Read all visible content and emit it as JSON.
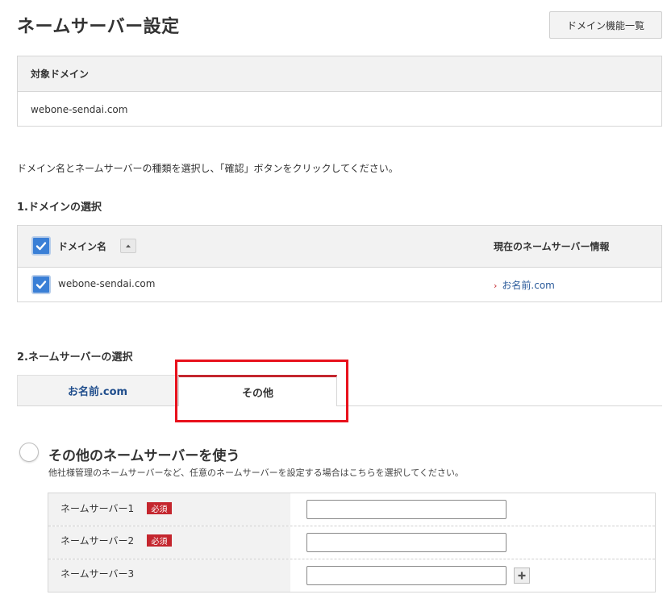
{
  "page": {
    "title": "ネームサーバー設定",
    "domain_list_button": "ドメイン機能一覧"
  },
  "target": {
    "header": "対象ドメイン",
    "value": "webone-sendai.com"
  },
  "instruction": "ドメイン名とネームサーバーの種類を選択し、「確認」ボタンをクリックしてください。",
  "step1": {
    "heading": "1.ドメインの選択",
    "columns": {
      "domain": "ドメイン名",
      "current_ns": "現在のネームサーバー情報"
    },
    "select_all_checked": true,
    "rows": [
      {
        "checked": true,
        "domain": "webone-sendai.com",
        "current_ns": "お名前.com"
      }
    ]
  },
  "step2": {
    "heading": "2.ネームサーバーの選択",
    "tabs": [
      {
        "label": "お名前.com",
        "active": false
      },
      {
        "label": "その他",
        "active": true
      }
    ],
    "option": {
      "title": "その他のネームサーバーを使う",
      "description": "他社様管理のネームサーバーなど、任意のネームサーバーを設定する場合はこちらを選択してください。",
      "selected": false
    },
    "nameservers": [
      {
        "label": "ネームサーバー1",
        "required": "必須",
        "value": ""
      },
      {
        "label": "ネームサーバー2",
        "required": "必須",
        "value": ""
      },
      {
        "label": "ネームサーバー3",
        "required": "",
        "value": ""
      }
    ]
  },
  "colors": {
    "accent_red": "#c4262e",
    "highlight_box": "#e8111c",
    "checkbox_blue": "#3a7fd6",
    "link_blue": "#1f4d8c"
  },
  "icons": [
    "checkbox-checked-icon",
    "sort-up-icon",
    "chevron-right-icon",
    "plus-icon"
  ]
}
